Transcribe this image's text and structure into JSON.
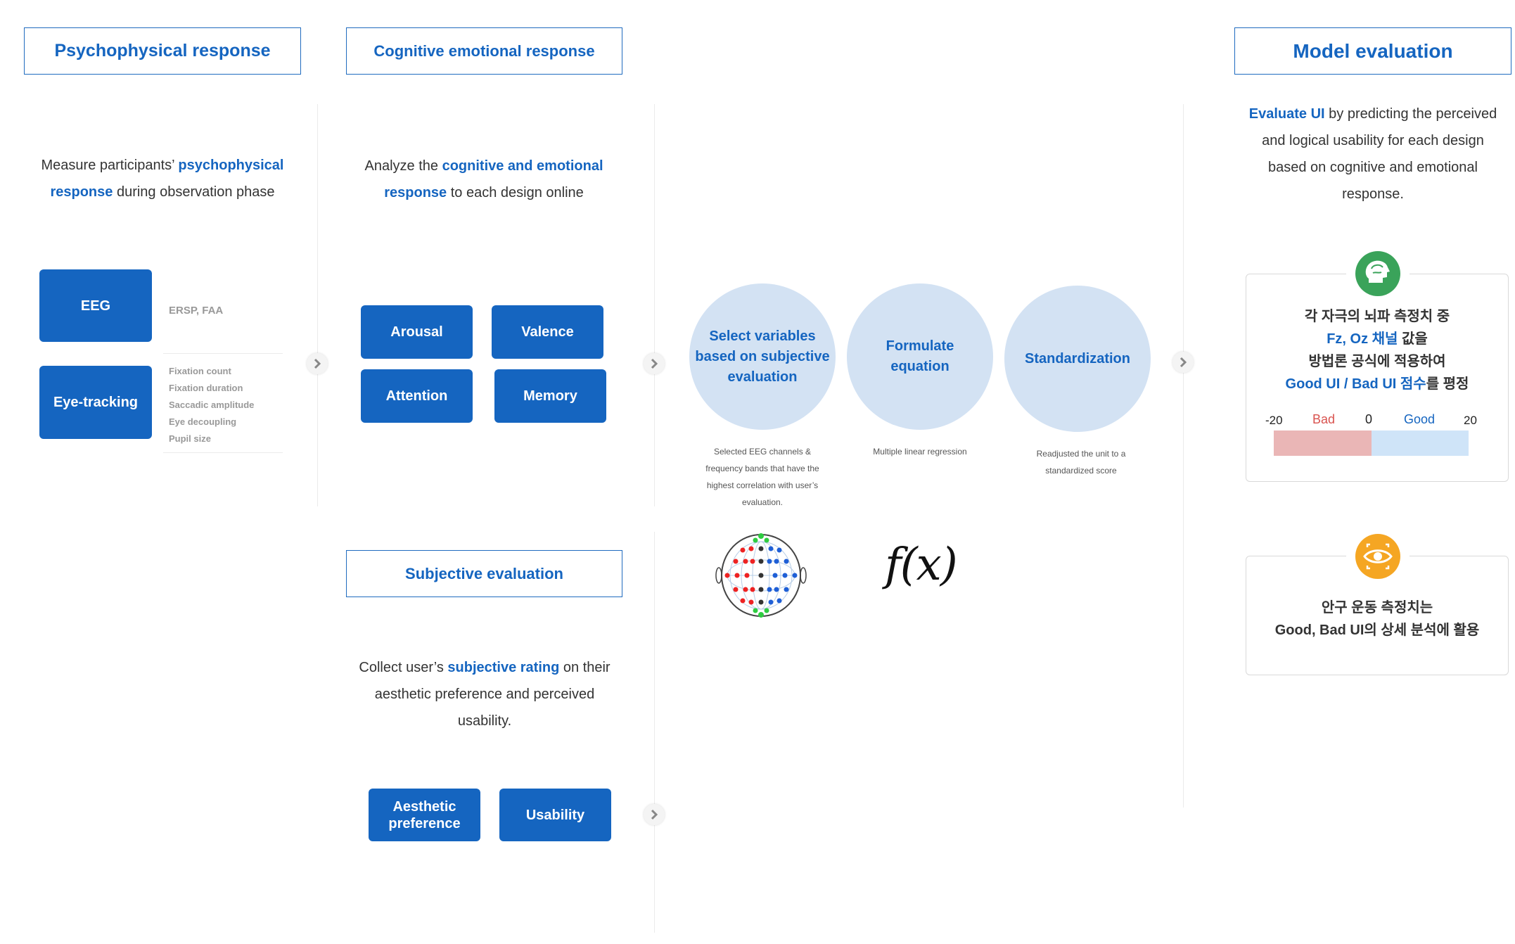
{
  "headers": {
    "psychophysical": "Psychophysical response",
    "cognitive": "Cognitive emotional response",
    "model": "Model evaluation",
    "subjective": "Subjective evaluation"
  },
  "psych": {
    "desc_pre": "Measure participants’ ",
    "desc_hl": "psychophysical response",
    "desc_post": " during observation phase",
    "eeg_label": "EEG",
    "eeg_metrics": "ERSP, FAA",
    "eye_label": "Eye-tracking",
    "eye_metrics": [
      "Fixation count",
      "Fixation duration",
      "Saccadic amplitude",
      "Eye decoupling",
      "Pupil size"
    ]
  },
  "cognitive": {
    "desc_pre": "Analyze the ",
    "desc_hl": "cognitive and emotional response",
    "desc_post": " to each design online",
    "buttons": [
      "Arousal",
      "Valence",
      "Attention",
      "Memory"
    ]
  },
  "subjective": {
    "desc_pre": "Collect user’s ",
    "desc_hl": "subjective rating",
    "desc_post": " on their aesthetic preference and perceived usability.",
    "buttons": [
      "Aesthetic preference",
      "Usability"
    ]
  },
  "process": {
    "steps": [
      {
        "title": "Select variables based on subjective evaluation",
        "caption": "Selected EEG channels & frequency bands that have the highest correlation with user’s evaluation."
      },
      {
        "title": "Formulate equation",
        "caption": "Multiple linear regression"
      },
      {
        "title": "Standardization",
        "caption": "Readjusted the unit to a standardized score"
      }
    ],
    "formula": "f(x)"
  },
  "model": {
    "desc_hl": "Evaluate UI",
    "desc_post": " by predicting the perceived and logical usability for each design based on cognitive and emotional response.",
    "card1": {
      "line1": "각 자극의 뇌파 측정치 중",
      "line2_hl": "Fz, Oz 채널",
      "line2_post": " 값을",
      "line3": "방법론 공식에 적용하여",
      "line4_hl": "Good UI / Bad UI 점수",
      "line4_post": "를 평정",
      "scale": {
        "min": "-20",
        "bad": "Bad",
        "zero": "0",
        "good": "Good",
        "max": "20"
      }
    },
    "card2": {
      "line1": "안구 운동 측정치는",
      "line2": "Good, Bad UI의 상세 분석에 활용"
    }
  },
  "colors": {
    "accent": "#1565c0",
    "circle": "#d3e2f3",
    "bad": "#eab6b6",
    "good": "#cfe4f8",
    "brain_icon": "#3aa35a",
    "eye_icon": "#f5a623"
  }
}
